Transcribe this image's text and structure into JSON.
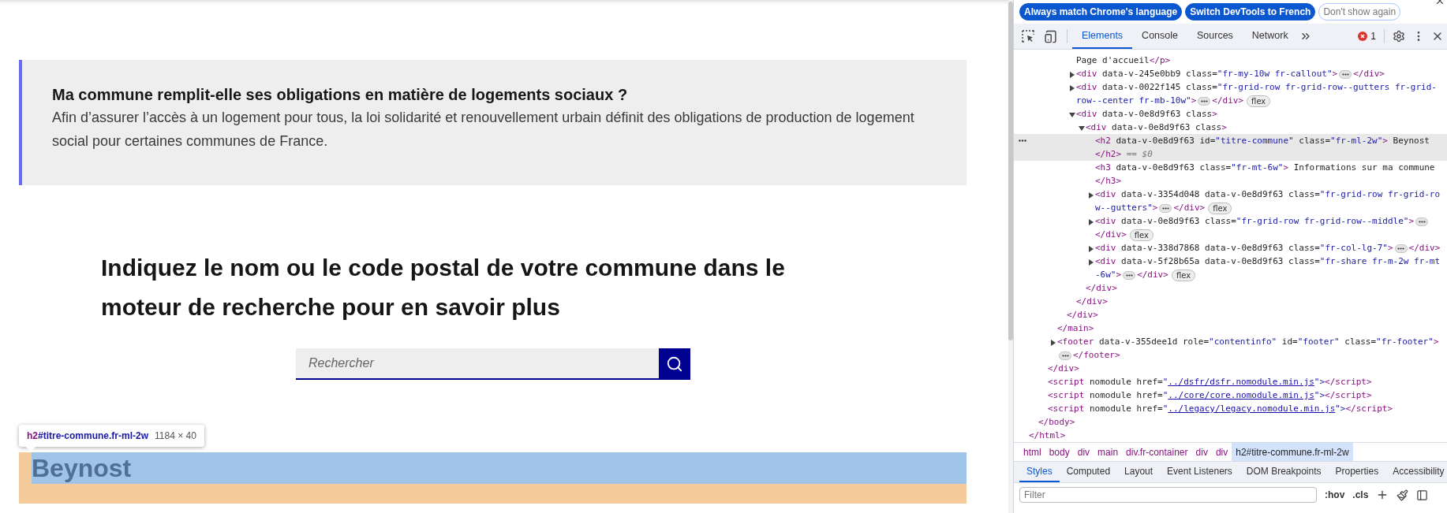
{
  "page": {
    "callout": {
      "title": "Ma commune remplit-elle ses obligations en matière de logements sociaux ?",
      "text": "Afin d’assurer l’accès à un logement pour tous, la loi solidarité et renouvellement urbain définit des obligations de production de logement social pour certaines communes de France."
    },
    "heading": "Indiquez le nom ou le code postal de votre commune dans le moteur de recherche pour en savoir plus",
    "search": {
      "placeholder": "Rechercher"
    },
    "inspect_tooltip": {
      "tag": "h2",
      "selector": "#titre-commune.fr-ml-2w",
      "size": "1184 × 40"
    },
    "commune_title": "Beynost"
  },
  "devtools": {
    "language_bar": {
      "buttons": [
        {
          "label": "Always match Chrome's language",
          "kind": "primary"
        },
        {
          "label": "Switch DevTools to French",
          "kind": "primary"
        },
        {
          "label": "Don't show again",
          "kind": "outline"
        }
      ]
    },
    "tabs": [
      {
        "label": "Elements",
        "selected": true
      },
      {
        "label": "Console",
        "selected": false
      },
      {
        "label": "Sources",
        "selected": false
      },
      {
        "label": "Network",
        "selected": false
      }
    ],
    "error_count": "1",
    "dom": [
      {
        "close": "</html>",
        "children": [
          {
            "close": "</body>",
            "children": [
              {
                "close": "</div>",
                "children": [
                  {
                    "close": "</main>",
                    "children": [
                      {
                        "close": "</div>",
                        "children": [
                          {
                            "open": "Page d'accueil</p>"
                          },
                          {
                            "open": "<div data-v-245e0bb9 class=\"fr-my-10w fr-callout\">",
                            "close": "</div>",
                            "collapsed": true
                          },
                          {
                            "open": "<div data-v-0022f145 class=\"fr-grid-row fr-grid-row--gutters fr-grid-row--center fr-mb-10w\">",
                            "close": "</div>",
                            "collapsed": true,
                            "badge": "flex"
                          },
                          {
                            "open": "<div data-v-0e8d9f63 class>",
                            "close": "</div>",
                            "children": [
                              {
                                "open": "<div data-v-0e8d9f63 class>",
                                "close": "</div>",
                                "children": [
                                  {
                                    "open": "<h2 data-v-0e8d9f63 id=\"titre-commune\" class=\"fr-ml-2w\"> Beynost",
                                    "close": "</h2>",
                                    "suffix": "== $0",
                                    "selected": true
                                  },
                                  {
                                    "open": "<h3 data-v-0e8d9f63 class=\"fr-mt-6w\"> Informations sur ma commune",
                                    "close": "</h3>",
                                    "selected": false
                                  },
                                  {
                                    "open": "<div data-v-3354d048 data-v-0e8d9f63 class=\"fr-grid-row fr-grid-row--gutters\">",
                                    "close": "</div>",
                                    "collapsed": true,
                                    "badge": "flex"
                                  },
                                  {
                                    "open": "<div data-v-0e8d9f63 class=\"fr-grid-row fr-grid-row--middle\">",
                                    "close": "</div>",
                                    "collapsed": true,
                                    "badge": "flex"
                                  },
                                  {
                                    "open": "<div data-v-338d7868 data-v-0e8d9f63 class=\"fr-col-lg-7\">",
                                    "close": "</div>",
                                    "collapsed": true
                                  },
                                  {
                                    "open": "<div data-v-5f28b65a data-v-0e8d9f63 class=\"fr-share fr-m-2w fr-mt-6w\">",
                                    "close": "</div>",
                                    "collapsed": true,
                                    "badge": "flex"
                                  }
                                ]
                              }
                            ]
                          }
                        ]
                      }
                    ]
                  },
                  {
                    "open": "<footer data-v-355dee1d role=\"contentinfo\" id=\"footer\" class=\"fr-footer\">",
                    "close": "</footer>",
                    "collapsed": true
                  }
                ]
              },
              {
                "open": "<script nomodule href=\"",
                "link": "../dsfr/dsfr.nomodule.min.js",
                "after": "\">",
                "close": "</script>"
              },
              {
                "open": "<script nomodule href=\"",
                "link": "../core/core.nomodule.min.js",
                "after": "\">",
                "close": "</script>"
              },
              {
                "open": "<script nomodule href=\"",
                "link": "../legacy/legacy.nomodule.min.js",
                "after": "\">",
                "close": "</script>"
              }
            ]
          }
        ]
      }
    ],
    "breadcrumbs": [
      {
        "label": "html",
        "selected": false
      },
      {
        "label": "body",
        "selected": false
      },
      {
        "label": "div",
        "selected": false
      },
      {
        "label": "main",
        "selected": false
      },
      {
        "label": "div.fr-container",
        "selected": false
      },
      {
        "label": "div",
        "selected": false
      },
      {
        "label": "div",
        "selected": false
      },
      {
        "label": "h2#titre-commune.fr-ml-2w",
        "selected": true
      }
    ],
    "sub_tabs": [
      {
        "label": "Styles",
        "selected": true
      },
      {
        "label": "Computed",
        "selected": false
      },
      {
        "label": "Layout",
        "selected": false
      },
      {
        "label": "Event Listeners",
        "selected": false
      },
      {
        "label": "DOM Breakpoints",
        "selected": false
      },
      {
        "label": "Properties",
        "selected": false
      },
      {
        "label": "Accessibility",
        "selected": false
      }
    ],
    "filter": {
      "placeholder": "Filter"
    },
    "style_tools": [
      ":hov",
      ".cls"
    ]
  }
}
